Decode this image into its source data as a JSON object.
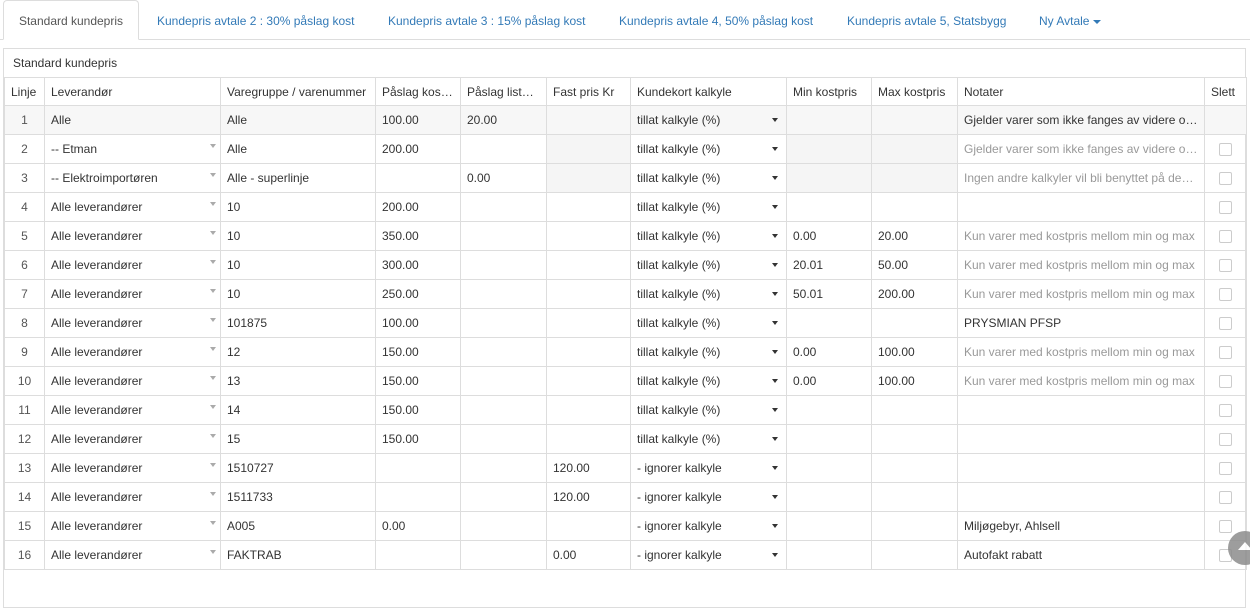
{
  "tabs": [
    {
      "label": "Standard kundepris",
      "active": true
    },
    {
      "label": "Kundepris avtale 2 : 30% påslag kost"
    },
    {
      "label": "Kundepris avtale 3 : 15% påslag kost"
    },
    {
      "label": "Kundepris avtale 4, 50% påslag kost"
    },
    {
      "label": "Kundepris avtale 5, Statsbygg"
    },
    {
      "label": "Ny Avtale"
    }
  ],
  "panel_title": "Standard kundepris",
  "columns": [
    "Linje",
    "Leverandør",
    "Varegruppe / varenummer",
    "Påslag kost %",
    "Påslag liste %",
    "Fast pris Kr",
    "Kundekort kalkyle",
    "Min kostpris",
    "Max kostpris",
    "Notater",
    "Slett"
  ],
  "rows": [
    {
      "linje": "1",
      "lev": "Alle",
      "vare": "Alle",
      "kost": "100.00",
      "liste": "20.00",
      "fast": "",
      "kalkyle": "tillat kalkyle (%)",
      "min": "",
      "max": "",
      "notat": "Gjelder varer som ikke fanges av videre op..."
    },
    {
      "linje": "2",
      "lev": "-- Etman",
      "vare": "Alle",
      "kost": "200.00",
      "liste": "",
      "fast": "",
      "kalkyle": "tillat kalkyle (%)",
      "min": "",
      "max": "",
      "notat": "Gjelder varer som ikke fanges av videre oppføring"
    },
    {
      "linje": "3",
      "lev": "-- Elektroimportøren",
      "vare": "Alle - superlinje",
      "kost": "",
      "liste": "0.00",
      "fast": "",
      "kalkyle": "tillat kalkyle (%)",
      "min": "",
      "max": "",
      "notat": "Ingen andre kalkyler vil bli benyttet på denne"
    },
    {
      "linje": "4",
      "lev": "Alle leverandører",
      "vare": "10",
      "kost": "200.00",
      "liste": "",
      "fast": "",
      "kalkyle": "tillat kalkyle (%)",
      "min": "",
      "max": "",
      "notat": ""
    },
    {
      "linje": "5",
      "lev": "Alle leverandører",
      "vare": "10",
      "kost": "350.00",
      "liste": "",
      "fast": "",
      "kalkyle": "tillat kalkyle (%)",
      "min": "0.00",
      "max": "20.00",
      "notat": "Kun varer med kostpris mellom min og max"
    },
    {
      "linje": "6",
      "lev": "Alle leverandører",
      "vare": "10",
      "kost": "300.00",
      "liste": "",
      "fast": "",
      "kalkyle": "tillat kalkyle (%)",
      "min": "20.01",
      "max": "50.00",
      "notat": "Kun varer med kostpris mellom min og max"
    },
    {
      "linje": "7",
      "lev": "Alle leverandører",
      "vare": "10",
      "kost": "250.00",
      "liste": "",
      "fast": "",
      "kalkyle": "tillat kalkyle (%)",
      "min": "50.01",
      "max": "200.00",
      "notat": "Kun varer med kostpris mellom min og max"
    },
    {
      "linje": "8",
      "lev": "Alle leverandører",
      "vare": "101875",
      "kost": "100.00",
      "liste": "",
      "fast": "",
      "kalkyle": "tillat kalkyle (%)",
      "min": "",
      "max": "",
      "notat": "PRYSMIAN PFSP"
    },
    {
      "linje": "9",
      "lev": "Alle leverandører",
      "vare": "12",
      "kost": "150.00",
      "liste": "",
      "fast": "",
      "kalkyle": "tillat kalkyle (%)",
      "min": "0.00",
      "max": "100.00",
      "notat": "Kun varer med kostpris mellom min og max"
    },
    {
      "linje": "10",
      "lev": "Alle leverandører",
      "vare": "13",
      "kost": "150.00",
      "liste": "",
      "fast": "",
      "kalkyle": "tillat kalkyle (%)",
      "min": "0.00",
      "max": "100.00",
      "notat": "Kun varer med kostpris mellom min og max"
    },
    {
      "linje": "11",
      "lev": "Alle leverandører",
      "vare": "14",
      "kost": "150.00",
      "liste": "",
      "fast": "",
      "kalkyle": "tillat kalkyle (%)",
      "min": "",
      "max": "",
      "notat": ""
    },
    {
      "linje": "12",
      "lev": "Alle leverandører",
      "vare": "15",
      "kost": "150.00",
      "liste": "",
      "fast": "",
      "kalkyle": "tillat kalkyle (%)",
      "min": "",
      "max": "",
      "notat": ""
    },
    {
      "linje": "13",
      "lev": "Alle leverandører",
      "vare": "1510727",
      "kost": "",
      "liste": "",
      "fast": "120.00",
      "kalkyle": "- ignorer kalkyle",
      "min": "",
      "max": "",
      "notat": ""
    },
    {
      "linje": "14",
      "lev": "Alle leverandører",
      "vare": "1511733",
      "kost": "",
      "liste": "",
      "fast": "120.00",
      "kalkyle": "- ignorer kalkyle",
      "min": "",
      "max": "",
      "notat": ""
    },
    {
      "linje": "15",
      "lev": "Alle leverandører",
      "vare": "A005",
      "kost": "0.00",
      "liste": "",
      "fast": "",
      "kalkyle": "- ignorer kalkyle",
      "min": "",
      "max": "",
      "notat": "Miljøgebyr, Ahlsell"
    },
    {
      "linje": "16",
      "lev": "Alle leverandører",
      "vare": "FAKTRAB",
      "kost": "",
      "liste": "",
      "fast": "0.00",
      "kalkyle": "- ignorer kalkyle",
      "min": "",
      "max": "",
      "notat": "Autofakt rabatt"
    }
  ]
}
